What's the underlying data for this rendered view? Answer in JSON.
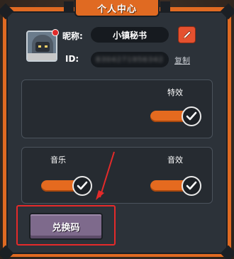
{
  "title": "个人中心",
  "profile": {
    "nickname_label": "昵称:",
    "nickname": "小镇秘书",
    "id_label": "ID:",
    "id_value": "8304271956342",
    "copy_label": "复制",
    "avatar_icon": "hooded-character-avatar",
    "notification_dot_color": "#e02a2a"
  },
  "settings": {
    "effects_label": "特效",
    "effects_on": true,
    "music_label": "音乐",
    "music_on": true,
    "sound_label": "音效",
    "sound_on": true
  },
  "redeem": {
    "button_label": "兑换码",
    "highlight_color": "#e52a2a"
  },
  "colors": {
    "accent_orange": "#e06a22",
    "panel_dark": "#2c3239",
    "toggle_on": "#e56a1f",
    "redeem_purple": "#7e6a8c",
    "edit_red": "#e5512f"
  }
}
